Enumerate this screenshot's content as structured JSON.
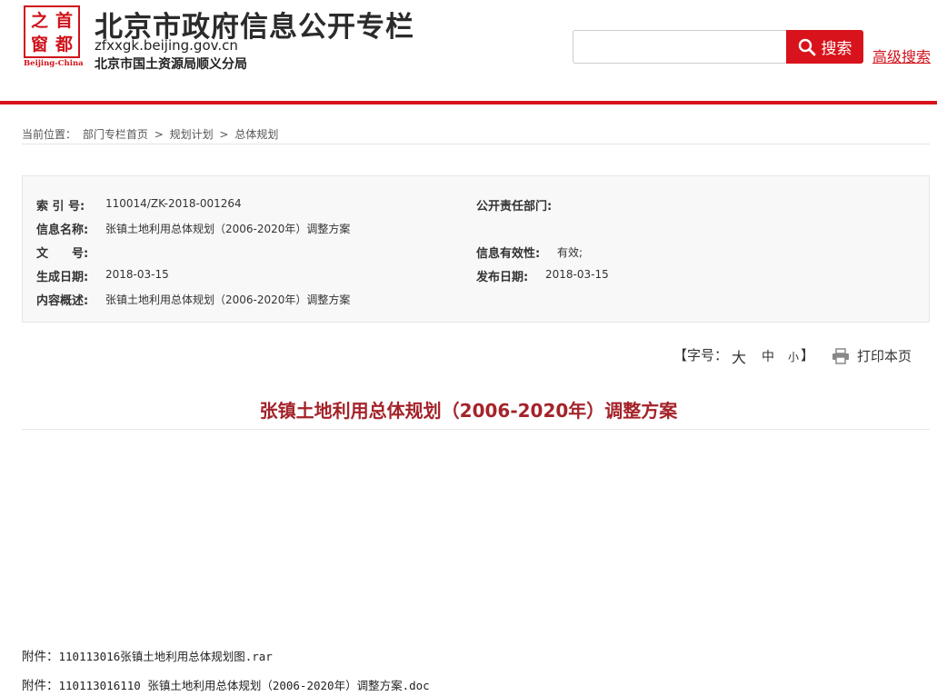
{
  "header": {
    "logo": {
      "chars": [
        "之",
        "首",
        "窗",
        "都"
      ],
      "sub": "Beijing-China"
    },
    "site_title": "北京市政府信息公开专栏",
    "site_url": "zfxxgk.beijing.gov.cn",
    "department": "北京市国土资源局顺义分局",
    "search": {
      "placeholder": "",
      "button_label": "搜索"
    },
    "advanced_search": "高级搜索",
    "accent_color": "#d8131b"
  },
  "breadcrumb": {
    "prefix": "当前位置：",
    "items": [
      "部门专栏首页",
      "规划计划",
      "总体规划"
    ],
    "separator": ">"
  },
  "info": {
    "index_label": "索 引 号:",
    "index_value": "110014/ZK-2018-001264",
    "dept_label": "公开责任部门:",
    "dept_value": "",
    "name_label": "信息名称:",
    "name_value": "张镇土地利用总体规划（2006-2020年）调整方案",
    "docno_label": "文　　号:",
    "docno_value": "",
    "validity_label": "信息有效性:",
    "validity_value": "有效;",
    "created_label": "生成日期:",
    "created_value": "2018-03-15",
    "published_label": "发布日期:",
    "published_value": "2018-03-15",
    "summary_label": "内容概述:",
    "summary_value": "张镇土地利用总体规划（2006-2020年）调整方案"
  },
  "tools": {
    "font_size_label": "【字号：",
    "large": "大",
    "medium": "中",
    "small": "小",
    "close_bracket": "】",
    "print_label": "打印本页"
  },
  "article": {
    "title": "张镇土地利用总体规划（2006-2020年）调整方案",
    "title_color": "#a4232a"
  },
  "attachments": [
    {
      "prefix": "附件：",
      "file": "110113016张镇土地利用总体规划图.rar"
    },
    {
      "prefix": "附件：",
      "file": "110113016110 张镇土地利用总体规划（2006-2020年）调整方案.doc"
    }
  ]
}
